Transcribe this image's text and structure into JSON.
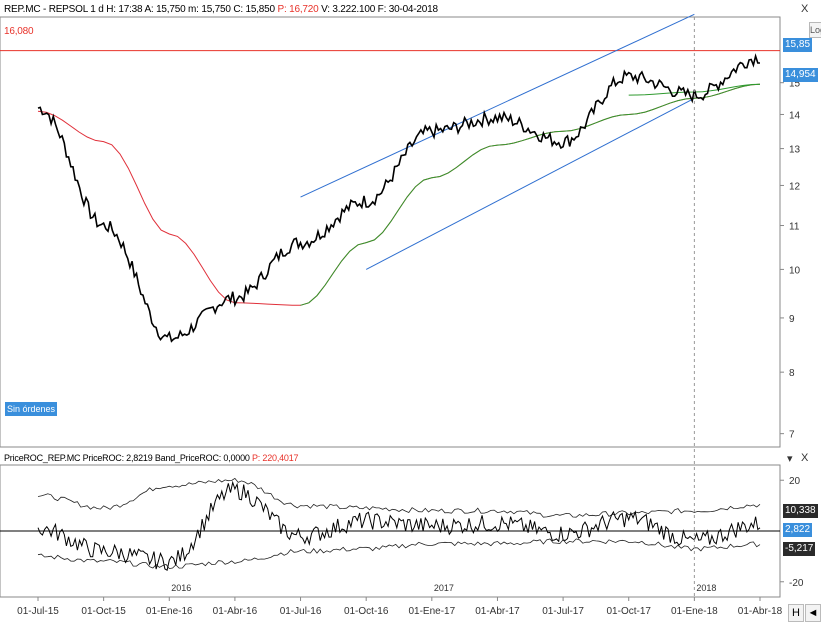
{
  "header": {
    "symbol": "REP.MC - REPSOL",
    "interval": "1 d",
    "high": "H: 17:38",
    "a_label": "A: 15,750",
    "m_label": "m: 15,750",
    "c_label": "C: 15,850",
    "p_label": "P: 16,720",
    "v_label": "V: 3.222.100",
    "f_label": "F: 30-04-2018"
  },
  "indicator_header": {
    "name": "PriceROC_REP.MC",
    "roc_label": "PriceROC: 2,8219",
    "band_label": "Band_PriceROC: 0,0000",
    "p_label": "P: 220,4017"
  },
  "price_panel": {
    "resistance_label": "16,080",
    "last_price_tag": "15,85",
    "ma_tag": "14,954",
    "scale_button": "Log",
    "status_label": "Sin órdenes"
  },
  "roc_panel": {
    "upper_tag": "10,338",
    "value_tag": "2,822",
    "lower_tag": "-5,217"
  },
  "controls": {
    "close": "X",
    "maximize": "X",
    "h_button": "H",
    "scroll_left": "◄"
  },
  "colors": {
    "resistance": "#e8322a",
    "ma_slow": "#e0303a",
    "ma_fast": "#2f9a2f",
    "channel": "#2f6fd0",
    "price": "#000000",
    "tag_blue": "#3a8fdc",
    "tag_dark": "#2a2a2a"
  },
  "chart_data": [
    {
      "type": "line",
      "title": "",
      "x": [
        "01-Jul-15",
        "01-Oct-15",
        "01-Ene-16",
        "01-Abr-16",
        "01-Jul-16",
        "01-Oct-16",
        "01-Ene-17",
        "01-Abr-17",
        "01-Jul-17",
        "01-Oct-17",
        "01-Ene-18",
        "01-Abr-18"
      ],
      "x_year_labels": [
        "2016",
        "2017",
        "2018"
      ],
      "y_ticks": [
        7,
        8,
        9,
        10,
        11,
        12,
        13,
        14,
        15
      ],
      "scale": "log",
      "series": [
        {
          "name": "",
          "values": [
            14.2,
            11.0,
            8.6,
            9.4,
            10.6,
            11.6,
            13.5,
            13.9,
            13.2,
            15.2,
            14.6,
            15.85
          ]
        },
        {
          "name": "",
          "values": [
            14.1,
            13.2,
            10.8,
            9.3,
            9.25,
            10.6,
            12.2,
            13.1,
            13.5,
            14.0,
            14.5,
            14.95
          ]
        },
        {
          "name": "",
          "values": [
            null,
            null,
            null,
            null,
            null,
            null,
            null,
            null,
            null,
            14.6,
            14.7,
            14.95
          ]
        }
      ],
      "annotations": [
        {
          "type": "horizontal_line",
          "value": 16.08
        },
        {
          "type": "channel_upper",
          "from": [
            "01-Jul-16",
            11.7
          ],
          "to": [
            "01-Ene-18",
            17.4
          ]
        },
        {
          "type": "channel_lower",
          "from": [
            "01-Oct-16",
            10.0
          ],
          "to": [
            "01-Ene-18",
            14.5
          ]
        }
      ]
    },
    {
      "type": "line",
      "title": "",
      "x": [
        "01-Jul-15",
        "01-Oct-15",
        "01-Ene-16",
        "01-Abr-16",
        "01-Jul-16",
        "01-Oct-16",
        "01-Ene-17",
        "01-Abr-17",
        "01-Jul-17",
        "01-Oct-17",
        "01-Ene-18",
        "01-Abr-18"
      ],
      "y_ticks": [
        20,
        0,
        -20
      ],
      "series": [
        {
          "name": "",
          "values": [
            1,
            -8,
            -12,
            16,
            -2,
            4,
            2,
            3,
            -1,
            5,
            -4,
            2.8
          ]
        },
        {
          "name": "",
          "values": [
            14,
            9,
            18,
            20,
            10,
            9,
            8,
            8,
            6,
            7,
            8,
            10.3
          ]
        },
        {
          "name": "",
          "values": [
            -10,
            -12,
            -14,
            -12,
            -8,
            -7,
            -5,
            -5,
            -4,
            -4,
            -7,
            -5.2
          ]
        }
      ]
    }
  ]
}
